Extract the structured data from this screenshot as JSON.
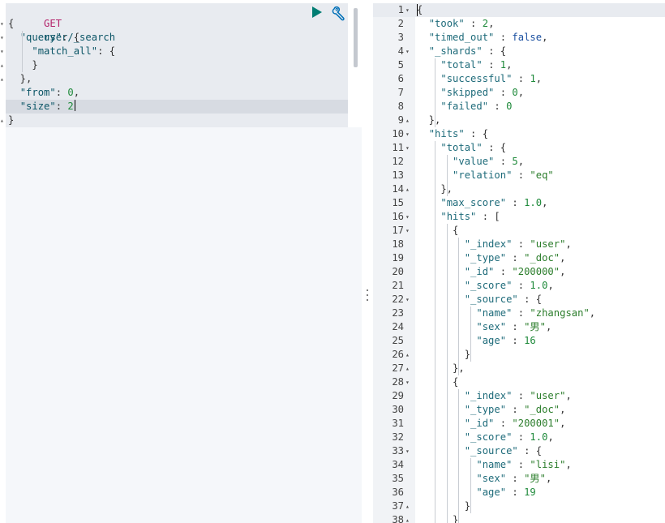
{
  "request": {
    "method": "GET",
    "path": "user/_search",
    "body_lines": [
      [
        {
          "t": "{",
          "c": "p"
        }
      ],
      [
        {
          "t": "  ",
          "c": "p"
        },
        {
          "t": "\"query\"",
          "c": "k"
        },
        {
          "t": ": {",
          "c": "p"
        }
      ],
      [
        {
          "t": "    ",
          "c": "p"
        },
        {
          "t": "\"match_all\"",
          "c": "k"
        },
        {
          "t": ": {",
          "c": "p"
        }
      ],
      [
        {
          "t": "    }",
          "c": "p"
        }
      ],
      [
        {
          "t": "  },",
          "c": "p"
        }
      ],
      [
        {
          "t": "  ",
          "c": "p"
        },
        {
          "t": "\"from\"",
          "c": "k"
        },
        {
          "t": ": ",
          "c": "p"
        },
        {
          "t": "0",
          "c": "num"
        },
        {
          "t": ",",
          "c": "p"
        }
      ],
      [
        {
          "t": "  ",
          "c": "p"
        },
        {
          "t": "\"size\"",
          "c": "k"
        },
        {
          "t": ": ",
          "c": "p"
        },
        {
          "t": "2",
          "c": "num"
        }
      ],
      [
        {
          "t": "}",
          "c": "p"
        }
      ]
    ],
    "active_line": 6
  },
  "actions": {
    "run_icon": "play-icon",
    "settings_icon": "wrench-icon",
    "accent_color": "#017d73"
  },
  "response": {
    "lines": [
      {
        "n": "1",
        "fold": "open",
        "seg": [
          {
            "t": "{",
            "c": "pun"
          }
        ]
      },
      {
        "n": "2",
        "seg": [
          {
            "t": "  ",
            "c": "pun"
          },
          {
            "t": "\"took\"",
            "c": "key"
          },
          {
            "t": " : ",
            "c": "pun"
          },
          {
            "t": "2",
            "c": "num"
          },
          {
            "t": ",",
            "c": "pun"
          }
        ]
      },
      {
        "n": "3",
        "seg": [
          {
            "t": "  ",
            "c": "pun"
          },
          {
            "t": "\"timed_out\"",
            "c": "key"
          },
          {
            "t": " : ",
            "c": "pun"
          },
          {
            "t": "false",
            "c": "bool"
          },
          {
            "t": ",",
            "c": "pun"
          }
        ]
      },
      {
        "n": "4",
        "fold": "open",
        "seg": [
          {
            "t": "  ",
            "c": "pun"
          },
          {
            "t": "\"_shards\"",
            "c": "key"
          },
          {
            "t": " : {",
            "c": "pun"
          }
        ]
      },
      {
        "n": "5",
        "seg": [
          {
            "t": "    ",
            "c": "pun"
          },
          {
            "t": "\"total\"",
            "c": "key"
          },
          {
            "t": " : ",
            "c": "pun"
          },
          {
            "t": "1",
            "c": "num"
          },
          {
            "t": ",",
            "c": "pun"
          }
        ]
      },
      {
        "n": "6",
        "seg": [
          {
            "t": "    ",
            "c": "pun"
          },
          {
            "t": "\"successful\"",
            "c": "key"
          },
          {
            "t": " : ",
            "c": "pun"
          },
          {
            "t": "1",
            "c": "num"
          },
          {
            "t": ",",
            "c": "pun"
          }
        ]
      },
      {
        "n": "7",
        "seg": [
          {
            "t": "    ",
            "c": "pun"
          },
          {
            "t": "\"skipped\"",
            "c": "key"
          },
          {
            "t": " : ",
            "c": "pun"
          },
          {
            "t": "0",
            "c": "num"
          },
          {
            "t": ",",
            "c": "pun"
          }
        ]
      },
      {
        "n": "8",
        "seg": [
          {
            "t": "    ",
            "c": "pun"
          },
          {
            "t": "\"failed\"",
            "c": "key"
          },
          {
            "t": " : ",
            "c": "pun"
          },
          {
            "t": "0",
            "c": "num"
          }
        ]
      },
      {
        "n": "9",
        "fold": "close",
        "seg": [
          {
            "t": "  },",
            "c": "pun"
          }
        ]
      },
      {
        "n": "10",
        "fold": "open",
        "seg": [
          {
            "t": "  ",
            "c": "pun"
          },
          {
            "t": "\"hits\"",
            "c": "key"
          },
          {
            "t": " : {",
            "c": "pun"
          }
        ]
      },
      {
        "n": "11",
        "fold": "open",
        "seg": [
          {
            "t": "    ",
            "c": "pun"
          },
          {
            "t": "\"total\"",
            "c": "key"
          },
          {
            "t": " : {",
            "c": "pun"
          }
        ]
      },
      {
        "n": "12",
        "seg": [
          {
            "t": "      ",
            "c": "pun"
          },
          {
            "t": "\"value\"",
            "c": "key"
          },
          {
            "t": " : ",
            "c": "pun"
          },
          {
            "t": "5",
            "c": "num"
          },
          {
            "t": ",",
            "c": "pun"
          }
        ]
      },
      {
        "n": "13",
        "seg": [
          {
            "t": "      ",
            "c": "pun"
          },
          {
            "t": "\"relation\"",
            "c": "key"
          },
          {
            "t": " : ",
            "c": "pun"
          },
          {
            "t": "\"eq\"",
            "c": "str"
          }
        ]
      },
      {
        "n": "14",
        "fold": "close",
        "seg": [
          {
            "t": "    },",
            "c": "pun"
          }
        ]
      },
      {
        "n": "15",
        "seg": [
          {
            "t": "    ",
            "c": "pun"
          },
          {
            "t": "\"max_score\"",
            "c": "key"
          },
          {
            "t": " : ",
            "c": "pun"
          },
          {
            "t": "1.0",
            "c": "num"
          },
          {
            "t": ",",
            "c": "pun"
          }
        ]
      },
      {
        "n": "16",
        "fold": "open",
        "seg": [
          {
            "t": "    ",
            "c": "pun"
          },
          {
            "t": "\"hits\"",
            "c": "key"
          },
          {
            "t": " : [",
            "c": "pun"
          }
        ]
      },
      {
        "n": "17",
        "fold": "open",
        "seg": [
          {
            "t": "      {",
            "c": "pun"
          }
        ]
      },
      {
        "n": "18",
        "seg": [
          {
            "t": "        ",
            "c": "pun"
          },
          {
            "t": "\"_index\"",
            "c": "key"
          },
          {
            "t": " : ",
            "c": "pun"
          },
          {
            "t": "\"user\"",
            "c": "str"
          },
          {
            "t": ",",
            "c": "pun"
          }
        ]
      },
      {
        "n": "19",
        "seg": [
          {
            "t": "        ",
            "c": "pun"
          },
          {
            "t": "\"_type\"",
            "c": "key"
          },
          {
            "t": " : ",
            "c": "pun"
          },
          {
            "t": "\"_doc\"",
            "c": "str"
          },
          {
            "t": ",",
            "c": "pun"
          }
        ]
      },
      {
        "n": "20",
        "seg": [
          {
            "t": "        ",
            "c": "pun"
          },
          {
            "t": "\"_id\"",
            "c": "key"
          },
          {
            "t": " : ",
            "c": "pun"
          },
          {
            "t": "\"200000\"",
            "c": "str"
          },
          {
            "t": ",",
            "c": "pun"
          }
        ]
      },
      {
        "n": "21",
        "seg": [
          {
            "t": "        ",
            "c": "pun"
          },
          {
            "t": "\"_score\"",
            "c": "key"
          },
          {
            "t": " : ",
            "c": "pun"
          },
          {
            "t": "1.0",
            "c": "num"
          },
          {
            "t": ",",
            "c": "pun"
          }
        ]
      },
      {
        "n": "22",
        "fold": "open",
        "seg": [
          {
            "t": "        ",
            "c": "pun"
          },
          {
            "t": "\"_source\"",
            "c": "key"
          },
          {
            "t": " : {",
            "c": "pun"
          }
        ]
      },
      {
        "n": "23",
        "seg": [
          {
            "t": "          ",
            "c": "pun"
          },
          {
            "t": "\"name\"",
            "c": "key"
          },
          {
            "t": " : ",
            "c": "pun"
          },
          {
            "t": "\"zhangsan\"",
            "c": "str"
          },
          {
            "t": ",",
            "c": "pun"
          }
        ]
      },
      {
        "n": "24",
        "seg": [
          {
            "t": "          ",
            "c": "pun"
          },
          {
            "t": "\"sex\"",
            "c": "key"
          },
          {
            "t": " : ",
            "c": "pun"
          },
          {
            "t": "\"男\"",
            "c": "str"
          },
          {
            "t": ",",
            "c": "pun"
          }
        ]
      },
      {
        "n": "25",
        "seg": [
          {
            "t": "          ",
            "c": "pun"
          },
          {
            "t": "\"age\"",
            "c": "key"
          },
          {
            "t": " : ",
            "c": "pun"
          },
          {
            "t": "16",
            "c": "num"
          }
        ]
      },
      {
        "n": "26",
        "fold": "close",
        "seg": [
          {
            "t": "        }",
            "c": "pun"
          }
        ]
      },
      {
        "n": "27",
        "fold": "close",
        "seg": [
          {
            "t": "      },",
            "c": "pun"
          }
        ]
      },
      {
        "n": "28",
        "fold": "open",
        "seg": [
          {
            "t": "      {",
            "c": "pun"
          }
        ]
      },
      {
        "n": "29",
        "seg": [
          {
            "t": "        ",
            "c": "pun"
          },
          {
            "t": "\"_index\"",
            "c": "key"
          },
          {
            "t": " : ",
            "c": "pun"
          },
          {
            "t": "\"user\"",
            "c": "str"
          },
          {
            "t": ",",
            "c": "pun"
          }
        ]
      },
      {
        "n": "30",
        "seg": [
          {
            "t": "        ",
            "c": "pun"
          },
          {
            "t": "\"_type\"",
            "c": "key"
          },
          {
            "t": " : ",
            "c": "pun"
          },
          {
            "t": "\"_doc\"",
            "c": "str"
          },
          {
            "t": ",",
            "c": "pun"
          }
        ]
      },
      {
        "n": "31",
        "seg": [
          {
            "t": "        ",
            "c": "pun"
          },
          {
            "t": "\"_id\"",
            "c": "key"
          },
          {
            "t": " : ",
            "c": "pun"
          },
          {
            "t": "\"200001\"",
            "c": "str"
          },
          {
            "t": ",",
            "c": "pun"
          }
        ]
      },
      {
        "n": "32",
        "seg": [
          {
            "t": "        ",
            "c": "pun"
          },
          {
            "t": "\"_score\"",
            "c": "key"
          },
          {
            "t": " : ",
            "c": "pun"
          },
          {
            "t": "1.0",
            "c": "num"
          },
          {
            "t": ",",
            "c": "pun"
          }
        ]
      },
      {
        "n": "33",
        "fold": "open",
        "seg": [
          {
            "t": "        ",
            "c": "pun"
          },
          {
            "t": "\"_source\"",
            "c": "key"
          },
          {
            "t": " : {",
            "c": "pun"
          }
        ]
      },
      {
        "n": "34",
        "seg": [
          {
            "t": "          ",
            "c": "pun"
          },
          {
            "t": "\"name\"",
            "c": "key"
          },
          {
            "t": " : ",
            "c": "pun"
          },
          {
            "t": "\"lisi\"",
            "c": "str"
          },
          {
            "t": ",",
            "c": "pun"
          }
        ]
      },
      {
        "n": "35",
        "seg": [
          {
            "t": "          ",
            "c": "pun"
          },
          {
            "t": "\"sex\"",
            "c": "key"
          },
          {
            "t": " : ",
            "c": "pun"
          },
          {
            "t": "\"男\"",
            "c": "str"
          },
          {
            "t": ",",
            "c": "pun"
          }
        ]
      },
      {
        "n": "36",
        "seg": [
          {
            "t": "          ",
            "c": "pun"
          },
          {
            "t": "\"age\"",
            "c": "key"
          },
          {
            "t": " : ",
            "c": "pun"
          },
          {
            "t": "19",
            "c": "num"
          }
        ]
      },
      {
        "n": "37",
        "fold": "close",
        "seg": [
          {
            "t": "        }",
            "c": "pun"
          }
        ]
      },
      {
        "n": "38",
        "fold": "close",
        "seg": [
          {
            "t": "      }",
            "c": "pun"
          }
        ]
      }
    ]
  }
}
